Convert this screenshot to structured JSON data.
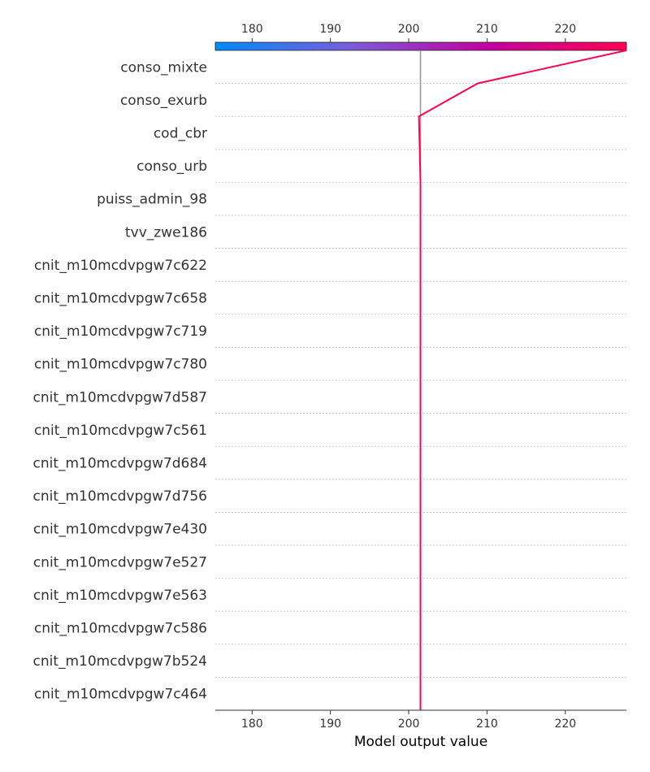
{
  "chart_data": {
    "type": "line",
    "chart_kind": "decision-plot",
    "xlabel": "Model output value",
    "xlim": [
      175.3,
      227.8
    ],
    "x_ticks": [
      180,
      190,
      200,
      210,
      220
    ],
    "base_value": 201.5,
    "colormap": [
      "#008bfb",
      "#7b5bd8",
      "#c3009f",
      "#ff0052"
    ],
    "line_color": "#ff0052",
    "base_line_color": "#999999",
    "grid": "dotted-horizontal",
    "features": [
      "conso_mixte",
      "conso_exurb",
      "cod_cbr",
      "conso_urb",
      "puiss_admin_98",
      "tvv_zwe186",
      "cnit_m10mcdvpgw7c622",
      "cnit_m10mcdvpgw7c658",
      "cnit_m10mcdvpgw7c719",
      "cnit_m10mcdvpgw7c780",
      "cnit_m10mcdvpgw7d587",
      "cnit_m10mcdvpgw7c561",
      "cnit_m10mcdvpgw7d684",
      "cnit_m10mcdvpgw7d756",
      "cnit_m10mcdvpgw7e430",
      "cnit_m10mcdvpgw7e527",
      "cnit_m10mcdvpgw7e563",
      "cnit_m10mcdvpgw7c586",
      "cnit_m10mcdvpgw7b524",
      "cnit_m10mcdvpgw7c464"
    ],
    "path_values": [
      227.8,
      208.8,
      201.3,
      201.4,
      201.5,
      201.5,
      201.5,
      201.5,
      201.5,
      201.5,
      201.5,
      201.5,
      201.5,
      201.5,
      201.5,
      201.5,
      201.5,
      201.5,
      201.5,
      201.5,
      201.5
    ]
  }
}
